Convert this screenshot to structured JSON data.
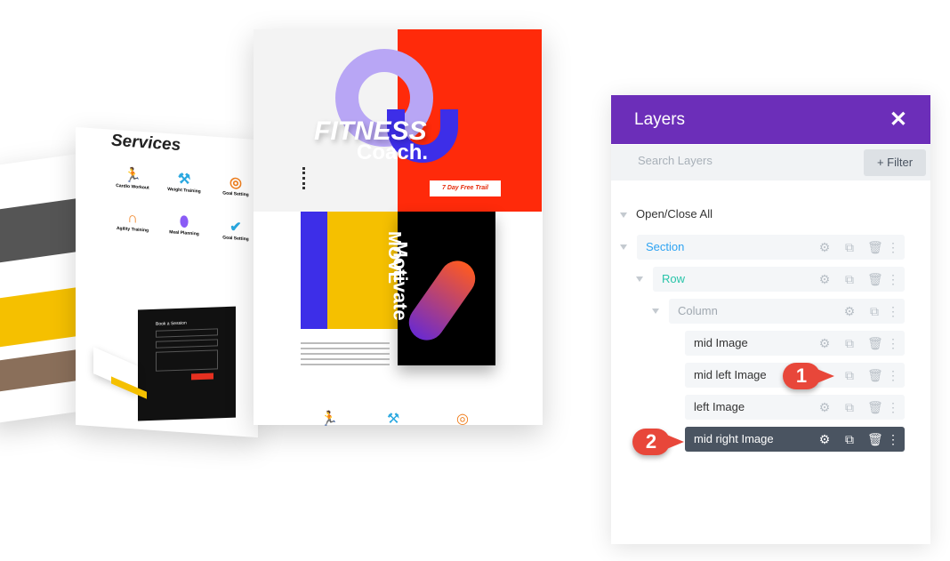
{
  "mockups": {
    "services": {
      "title": "Services",
      "items": [
        "Cardio Workout",
        "Weight Training",
        "Goal Setting",
        "Agility Training",
        "Meal Planning",
        "Goal Setting"
      ]
    },
    "form": {
      "title": "Book a Session"
    },
    "fitness": {
      "title1": "FITNESS",
      "title2": "Coach.",
      "cta": "7 Day Free Trail",
      "move": "MOVE",
      "motivate": "Motivate"
    }
  },
  "layers": {
    "title": "Layers",
    "close_icon": "close-icon",
    "search_placeholder": "Search Layers",
    "filter_label": "+ Filter",
    "open_close_all": "Open/Close All",
    "tree": [
      {
        "label": "Section",
        "color": "#2ea3f2"
      },
      {
        "label": "Row",
        "color": "#29c4a9"
      },
      {
        "label": "Column",
        "color": "#a0a8b0"
      },
      {
        "label": "mid Image"
      },
      {
        "label": "mid left Image"
      },
      {
        "label": "left Image"
      },
      {
        "label": "mid right Image",
        "selected": true
      }
    ],
    "colors": {
      "header": "#6c2eb9",
      "selected": "#4a5461",
      "callout": "#e8473a"
    }
  },
  "callouts": [
    "1",
    "2"
  ]
}
